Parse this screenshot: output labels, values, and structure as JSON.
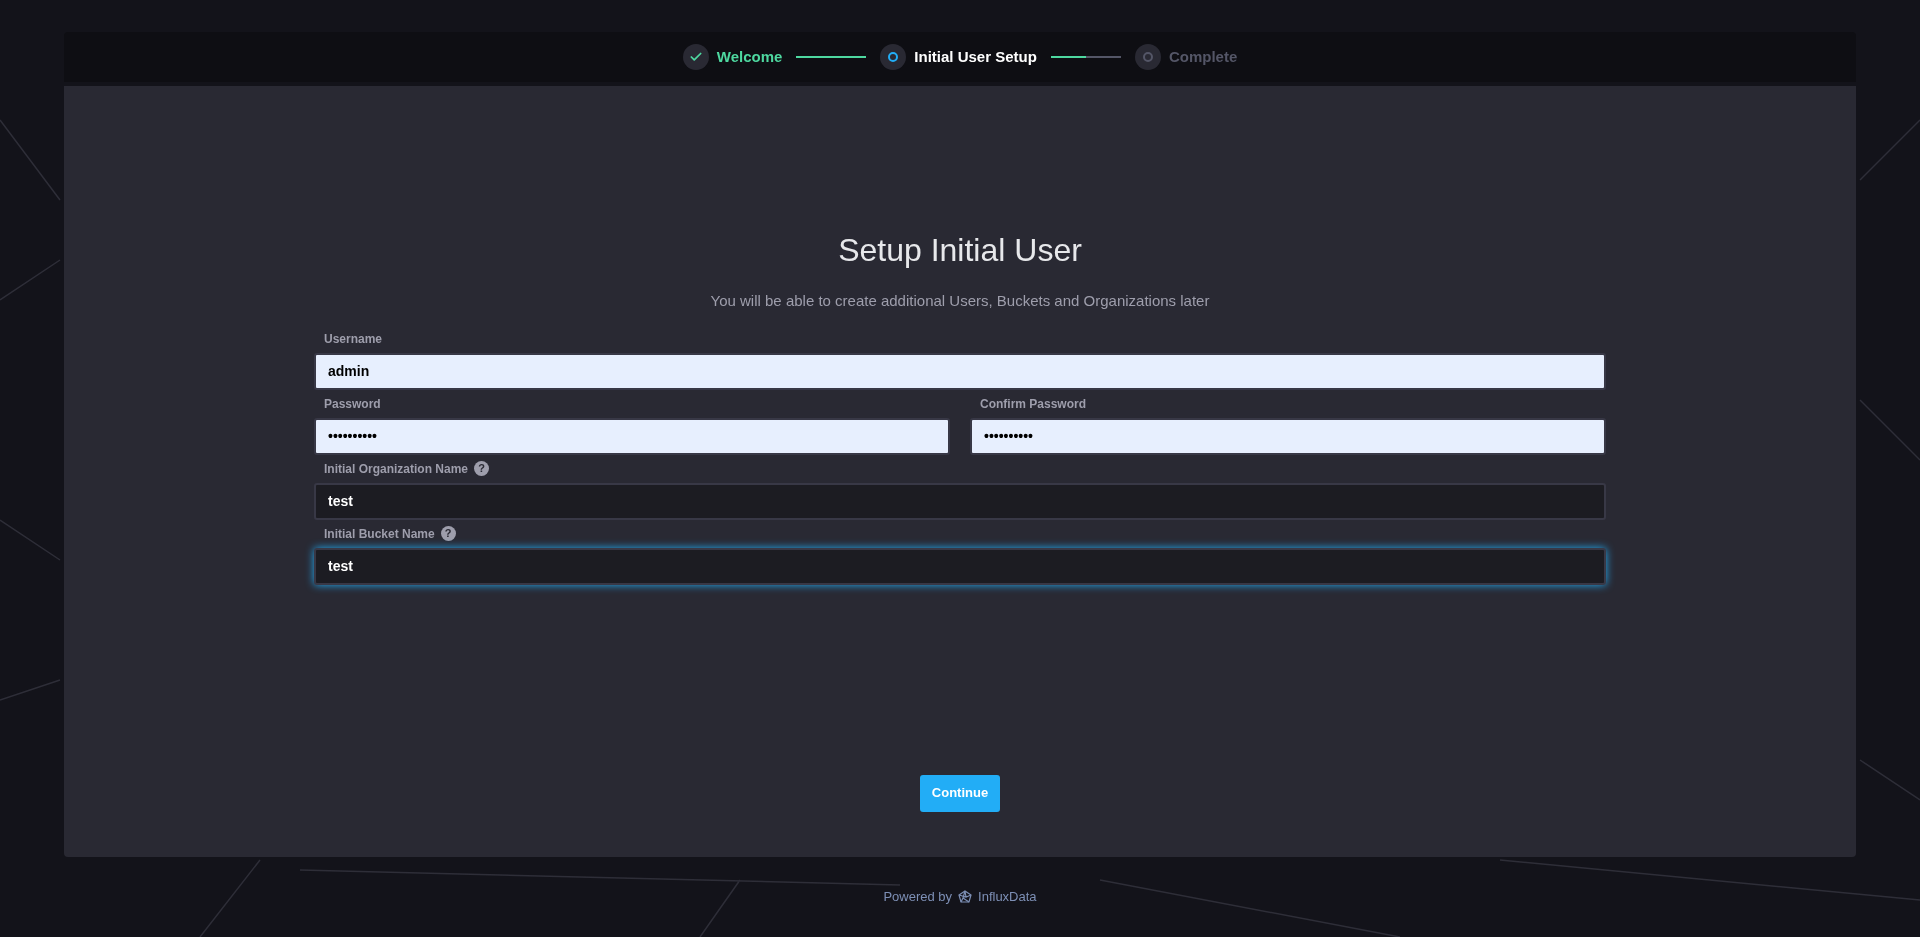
{
  "stepper": {
    "steps": [
      {
        "label": "Welcome",
        "kind": "complete"
      },
      {
        "label": "Initial User Setup",
        "kind": "current"
      },
      {
        "label": "Complete",
        "kind": "pending"
      }
    ],
    "connectors": [
      {
        "level": 1
      },
      {
        "level": 0.5
      }
    ]
  },
  "form": {
    "title": "Setup Initial User",
    "subtitle": "You will be able to create additional Users, Buckets and Organizations later",
    "rows": [
      [
        {
          "label": "Username",
          "value": "admin",
          "kind": "light",
          "focused": false
        }
      ],
      [
        {
          "label": "Password",
          "value": "••••••••••",
          "kind": "light",
          "focused": false
        },
        {
          "label": "Confirm Password",
          "value": "••••••••••",
          "kind": "light",
          "focused": false
        }
      ],
      [
        {
          "label": "Initial Organization Name",
          "value": "test",
          "kind": "dark",
          "help": "?",
          "focused": false
        }
      ],
      [
        {
          "label": "Initial Bucket Name",
          "value": "test",
          "kind": "dark",
          "help": "?",
          "focused": true
        }
      ]
    ],
    "button": "Continue"
  },
  "footer": {
    "prefix": "Powered by",
    "brand": "InfluxData"
  }
}
